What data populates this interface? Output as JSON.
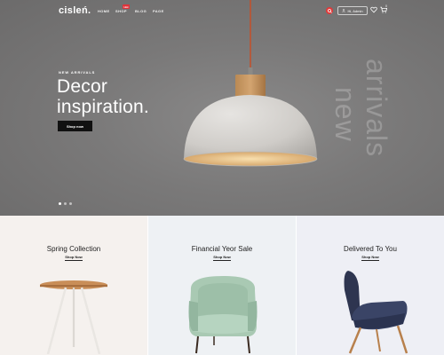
{
  "brand": {
    "logo": "cisleń."
  },
  "nav": {
    "items": [
      {
        "label": "HOME"
      },
      {
        "label": "SHOP",
        "badge": "Hot"
      },
      {
        "label": "BLOG"
      },
      {
        "label": "PAGE"
      }
    ]
  },
  "header": {
    "search_icon": "search-icon",
    "account_label": "Hi, Admin",
    "wishlist_icon": "heart-icon",
    "cart_icon": "cart-icon",
    "cart_count": "0",
    "accent_color": "#e03a3a"
  },
  "hero": {
    "tag": "NEW ARRIVALS",
    "headline_line1": "Decor",
    "headline_line2": "inspiration.",
    "cta": "Shop now",
    "vertical_text_1": "arrivals",
    "vertical_text_2": "new",
    "slides": 3,
    "active_slide": 1
  },
  "collections": [
    {
      "title": "Spring Collection",
      "link": "Shop Now",
      "bg": "#f5f1ee"
    },
    {
      "title": "Financial Yeor Sale",
      "link": "Shop Now",
      "bg": "#eef1f4"
    },
    {
      "title": "Delivered To You",
      "link": "Shop Now",
      "bg": "#eeeff5"
    }
  ]
}
